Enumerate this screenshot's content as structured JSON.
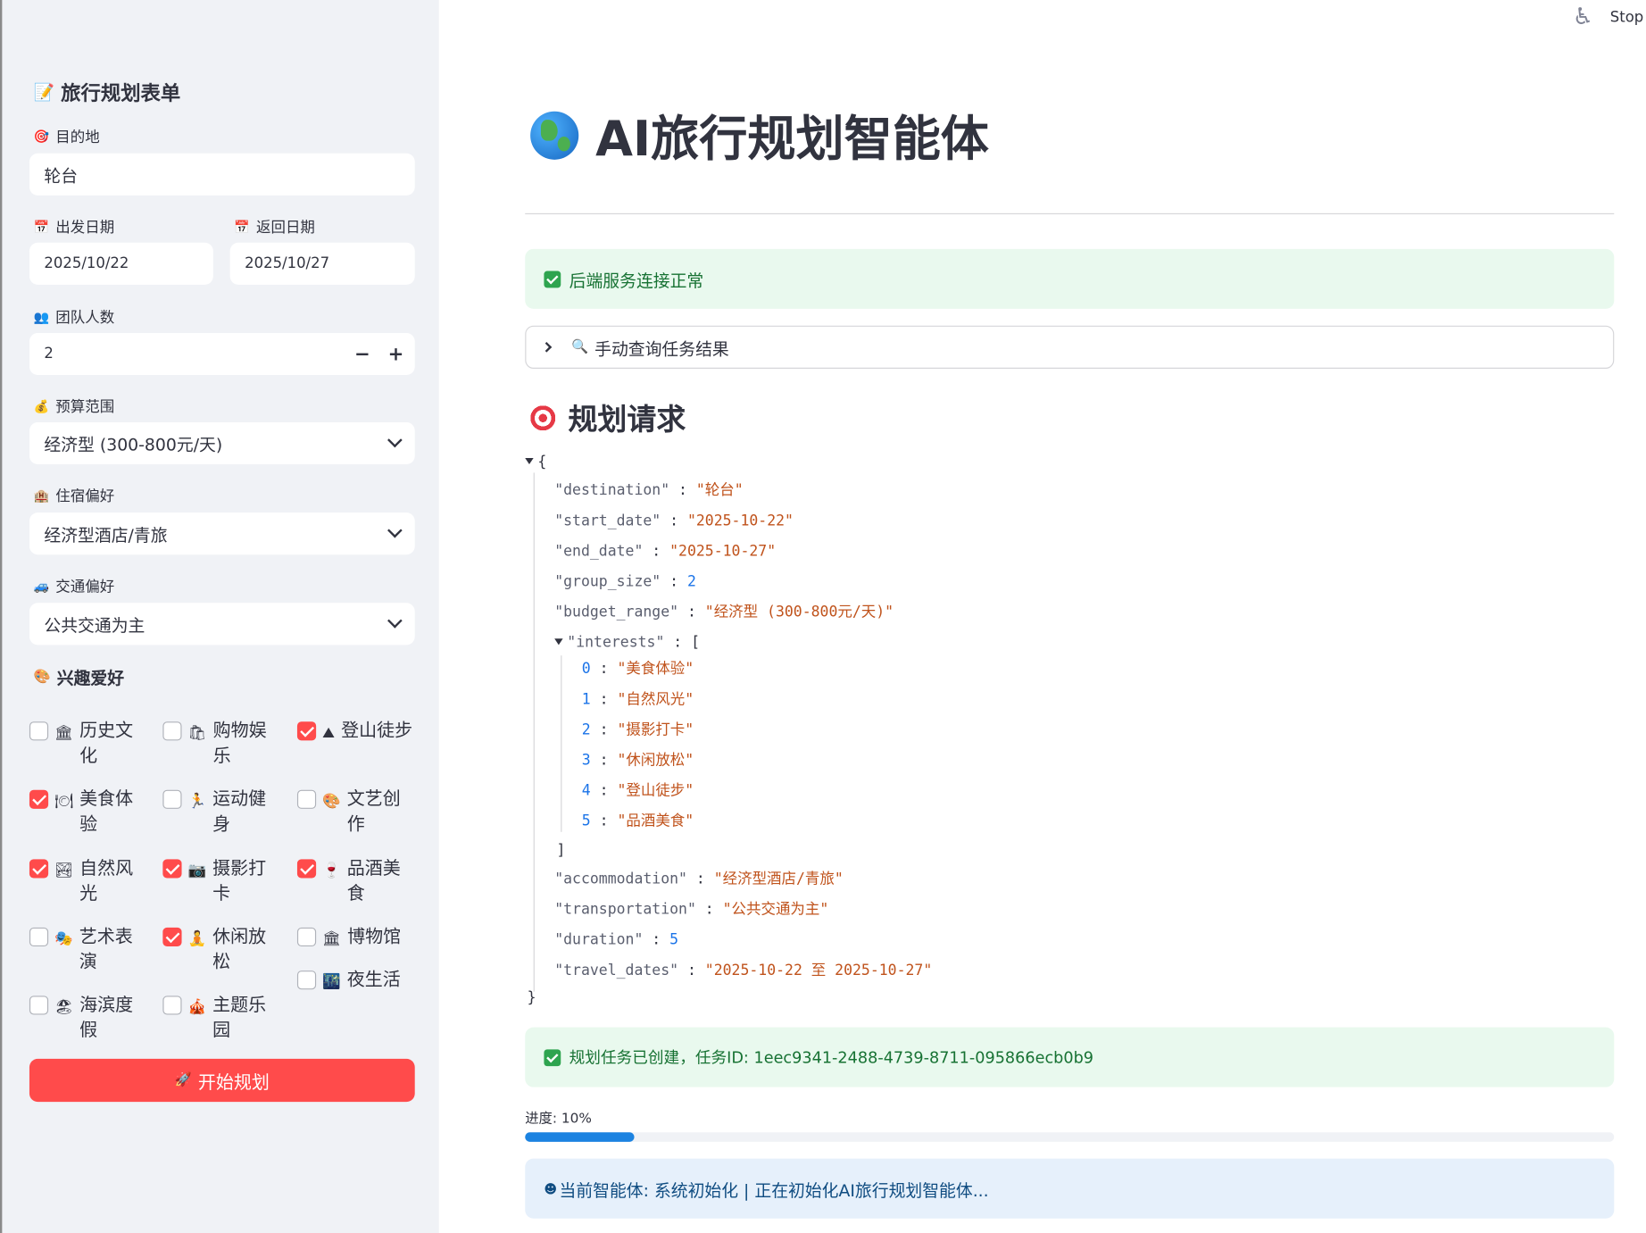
{
  "sidebar": {
    "title": "旅行规划表单",
    "destination_label": "目的地",
    "destination_value": "轮台",
    "start_label": "出发日期",
    "start_value": "2025/10/22",
    "return_label": "返回日期",
    "return_value": "2025/10/27",
    "group_label": "团队人数",
    "group_value": "2",
    "minus": "−",
    "plus": "+",
    "budget_label": "预算范围",
    "budget_value": "经济型 (300-800元/天)",
    "accom_label": "住宿偏好",
    "accom_value": "经济型酒店/青旅",
    "transport_label": "交通偏好",
    "transport_value": "公共交通为主",
    "interests_title": "兴趣爱好",
    "interests": [
      {
        "label": "历史文化",
        "checked": false,
        "icon": "classical-building-icon"
      },
      {
        "label": "购物娱乐",
        "checked": false,
        "icon": "shopping-bags-icon"
      },
      {
        "label": "登山徒步",
        "checked": true,
        "icon": "mountain-icon"
      },
      {
        "label": "美食体验",
        "checked": true,
        "icon": "plate-icon"
      },
      {
        "label": "运动健身",
        "checked": false,
        "icon": "runner-icon"
      },
      {
        "label": "文艺创作",
        "checked": false,
        "icon": "palette-icon"
      },
      {
        "label": "自然风光",
        "checked": true,
        "icon": "landscape-icon"
      },
      {
        "label": "摄影打卡",
        "checked": true,
        "icon": "camera-icon"
      },
      {
        "label": "品酒美食",
        "checked": true,
        "icon": "wine-glass-icon"
      },
      {
        "label": "艺术表演",
        "checked": false,
        "icon": "masks-icon"
      },
      {
        "label": "休闲放松",
        "checked": true,
        "icon": "lotus-position-icon"
      },
      {
        "label": "博物馆",
        "checked": false,
        "icon": "museum-icon"
      },
      {
        "label": "夜生活",
        "checked": false,
        "icon": "night-city-icon"
      },
      {
        "label": "海滨度假",
        "checked": false,
        "icon": "beach-umbrella-icon"
      },
      {
        "label": "主题乐园",
        "checked": false,
        "icon": "circus-tent-icon"
      }
    ],
    "start_button": "开始规划"
  },
  "topbar": {
    "stop": "Stop"
  },
  "main": {
    "title": "AI旅行规划智能体",
    "backend_status": "后端服务连接正常",
    "expander_label": "手动查询任务结果",
    "request_title": "规划请求",
    "task_created": "规划任务已创建，任务ID: 1eec9341-2488-4739-8711-095866ecb0b9",
    "progress_label": "进度: 10%",
    "progress_value": 0.1,
    "agent_status": "当前智能体: 系统初始化 | 正在初始化AI旅行规划智能体..."
  },
  "json_view": {
    "destination": "\"轮台\"",
    "start_date": "\"2025-10-22\"",
    "end_date": "\"2025-10-27\"",
    "group_size": "2",
    "budget_range": "\"经济型 (300-800元/天)\"",
    "interests": [
      "\"美食体验\"",
      "\"自然风光\"",
      "\"摄影打卡\"",
      "\"休闲放松\"",
      "\"登山徒步\"",
      "\"品酒美食\""
    ],
    "accommodation": "\"经济型酒店/青旅\"",
    "transportation": "\"公共交通为主\"",
    "duration": "5",
    "travel_dates": "\"2025-10-22 至 2025-10-27\""
  },
  "colors": {
    "primary": "#ff4b4b",
    "success_bg": "#e9f9ee",
    "info_bg": "#e6f0fb",
    "progress": "#1c83e1"
  }
}
